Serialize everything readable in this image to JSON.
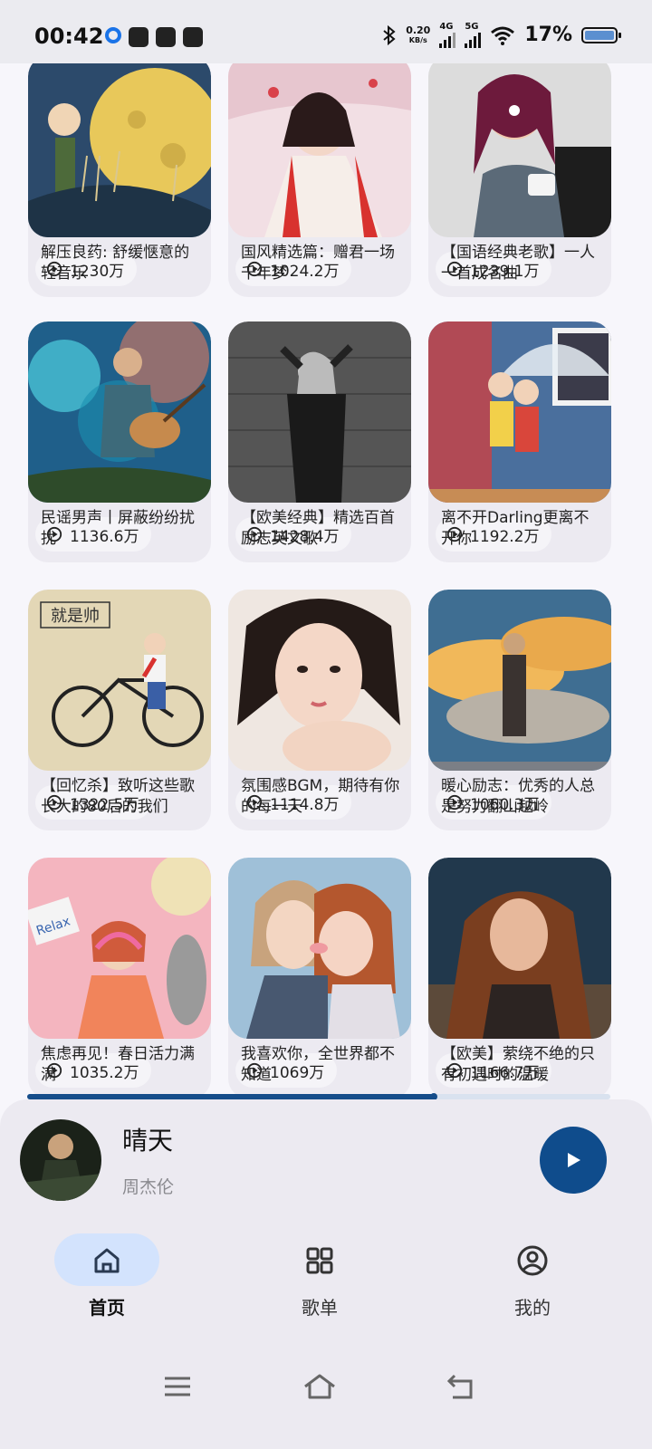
{
  "status": {
    "time": "00:42",
    "speed_top": "0.20",
    "speed_unit": "KB/s",
    "net1": "4G",
    "net2": "5G",
    "battery": "17%"
  },
  "cards": [
    {
      "count": "1230万",
      "title": "解压良药: 舒缓惬意的轻音乐"
    },
    {
      "count": "1024.2万",
      "title": "国风精选篇：赠君一场千年梦"
    },
    {
      "count": "1239.1万",
      "title": "【国语经典老歌】一人一首成名曲"
    },
    {
      "count": "1136.6万",
      "title": "民谣男声丨屏蔽纷纷扰扰"
    },
    {
      "count": "1428.4万",
      "title": "【欧美经典】精选百首励志英文歌"
    },
    {
      "count": "1192.2万",
      "title": "离不开Darling更离不开你"
    },
    {
      "count": "1322.5万",
      "title": "【回忆杀】致听这些歌长大的80后的我们"
    },
    {
      "count": "1114.8万",
      "title": "氛围感BGM，期待有你的每一天"
    },
    {
      "count": "1060.3万",
      "title": "暖心励志：优秀的人总是努力翻山越岭"
    },
    {
      "count": "1035.2万",
      "title": "焦虑再见！春日活力满满"
    },
    {
      "count": "1069万",
      "title": "我喜欢你，全世界都不知道"
    },
    {
      "count": "1166.7万",
      "title": "【欧美】萦绕不绝的只有初遇时的温暖"
    }
  ],
  "card_art_text": {
    "bike_caption": "就是帅",
    "relax": "Relax"
  },
  "player": {
    "song": "晴天",
    "artist": "周杰伦",
    "progress": 0.7
  },
  "nav": [
    {
      "label": "首页",
      "icon": "home-icon",
      "active": true
    },
    {
      "label": "歌单",
      "icon": "grid-icon",
      "active": false
    },
    {
      "label": "我的",
      "icon": "profile-icon",
      "active": false
    }
  ],
  "colors": {
    "accent": "#0f4c8c",
    "active_pill": "#d3e3fd",
    "card_bg": "#eceaf1"
  }
}
